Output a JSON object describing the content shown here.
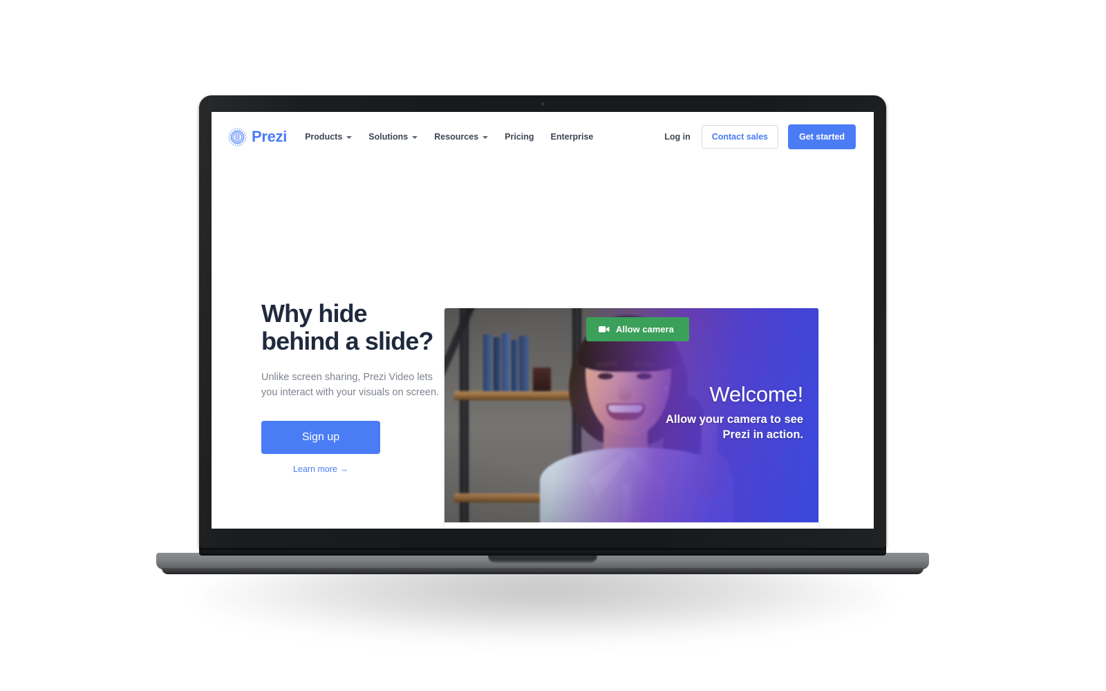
{
  "site": {
    "brand_name": "Prezi",
    "brand_color": "#4a7cf5"
  },
  "nav": {
    "links": [
      {
        "label": "Products",
        "has_caret": true
      },
      {
        "label": "Solutions",
        "has_caret": true
      },
      {
        "label": "Resources",
        "has_caret": true
      },
      {
        "label": "Pricing",
        "has_caret": false
      },
      {
        "label": "Enterprise",
        "has_caret": false
      }
    ],
    "login_label": "Log in",
    "contact_sales_label": "Contact sales",
    "get_started_label": "Get started"
  },
  "hero": {
    "title": "Why hide\nbehind a slide?",
    "subtitle": "Unlike screen sharing, Prezi Video lets you interact with your visuals on screen.",
    "signup_label": "Sign up",
    "learn_more_label": "Learn more →"
  },
  "video": {
    "allow_camera_label": "Allow camera",
    "allow_camera_color": "#3aa05a",
    "welcome_title": "Welcome!",
    "welcome_subtitle": "Allow your camera to see\nPrezi in action.",
    "overlay_gradient_from": "#7a38ba",
    "overlay_gradient_to": "#3848e2",
    "toolbar": {
      "layout_buttons": [
        {
          "name": "presenter-only",
          "active": false
        },
        {
          "name": "presenter-with-content",
          "active": true
        },
        {
          "name": "content-only",
          "active": false
        }
      ],
      "prev_label": "←",
      "next_label": "→"
    }
  }
}
